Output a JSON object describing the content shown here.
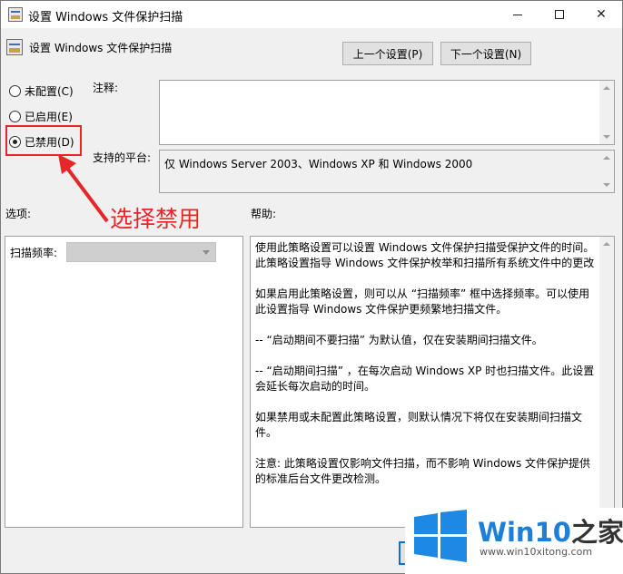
{
  "window": {
    "title": "设置 Windows 文件保护扫描"
  },
  "header": {
    "policy_name": "设置 Windows 文件保护扫描",
    "prev_button": "上一个设置(P)",
    "next_button": "下一个设置(N)"
  },
  "state": {
    "options": [
      {
        "label": "未配置(C)",
        "selected": false
      },
      {
        "label": "已启用(E)",
        "selected": false
      },
      {
        "label": "已禁用(D)",
        "selected": true
      }
    ]
  },
  "fields": {
    "comment_label": "注释:",
    "comment_value": "",
    "platform_label": "支持的平台:",
    "platform_value": "仅 Windows Server 2003、Windows XP 和 Windows 2000"
  },
  "sections": {
    "options_label": "选项:",
    "help_label": "帮助:"
  },
  "options_panel": {
    "scan_frequency_label": "扫描频率:",
    "scan_frequency_value": ""
  },
  "help": {
    "paragraphs": [
      "使用此策略设置可以设置 Windows 文件保护扫描受保护文件的时间。此策略设置指导 Windows 文件保护枚举和扫描所有系统文件中的更改",
      "如果启用此策略设置，则可以从 “扫描频率” 框中选择频率。可以使用此设置指导 Windows 文件保护更频繁地扫描文件。",
      "-- “启动期间不要扫描” 为默认值，仅在安装期间扫描文件。",
      "-- “启动期间扫描” ，在每次启动 Windows XP 时也扫描文件。此设置会延长每次启动的时间。",
      "如果禁用或未配置此策略设置，则默认情况下将仅在安装期间扫描文件。",
      "注意: 此策略设置仅影响文件扫描，而不影响 Windows 文件保护提供的标准后台文件更改检测。"
    ]
  },
  "annotation": {
    "text": "选择禁用",
    "color": "#e8262a"
  },
  "watermark": {
    "brand": "Win10",
    "brand_suffix": "之家",
    "url": "www.win10xitong.com"
  }
}
